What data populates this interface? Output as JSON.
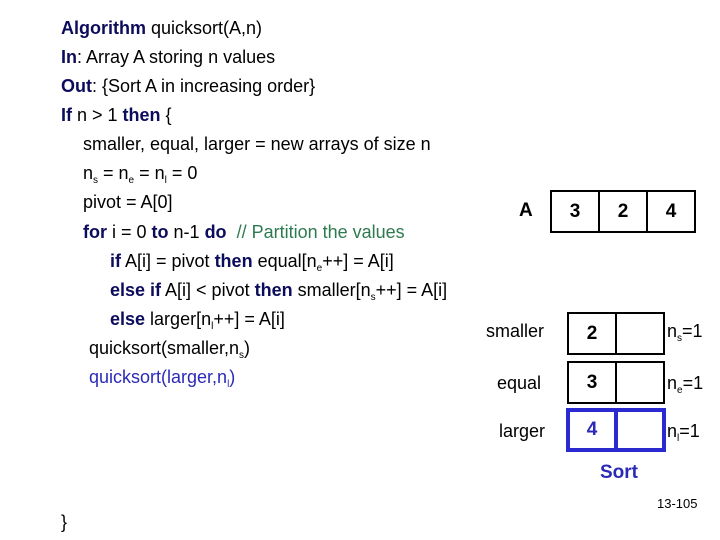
{
  "code": {
    "line1": {
      "kw": "Algorithm",
      "text": " quicksort(A,n)"
    },
    "line2": {
      "kw": "In",
      "text": ": Array A storing n values"
    },
    "line3": {
      "kw": "Out",
      "text": ": {Sort A in increasing order}"
    },
    "line4": {
      "kw1": "If",
      "text1": " n > 1 ",
      "kw2": "then",
      "text2": " {"
    },
    "line5": {
      "text": "smaller, equal, larger = new arrays of size n"
    },
    "line6": {
      "n1": "n",
      "s1": "s",
      "eq1": " = n",
      "s2": "e",
      "eq2": " = n",
      "s3": "l",
      "eq3": " = 0"
    },
    "line7": {
      "text": "pivot = A[0]"
    },
    "line8": {
      "kw1": "for",
      "text1": " i = 0 ",
      "kw2": "to",
      "text2": " n-1 ",
      "kw3": "do",
      "comment": "  // Partition the values"
    },
    "line9": {
      "kw1": "if",
      "text1": " A[i] = pivot ",
      "kw2": "then",
      "text2": " equal[n",
      "sub": "e",
      "text3": "++] = A[i]"
    },
    "line10": {
      "kw1": "else if",
      "text1": " A[i] < pivot ",
      "kw2": "then",
      "text2": " smaller[n",
      "sub": "s",
      "text3": "++] = A[i]"
    },
    "line11": {
      "kw1": "else",
      "text1": " larger[n",
      "sub": "l",
      "text2": "++] = A[i]"
    },
    "line12": {
      "text": "quicksort(smaller,n",
      "sub": "s",
      "text2": ")"
    },
    "line13": {
      "text": "quicksort(larger,n",
      "sub": "l",
      "text2": ")"
    },
    "closing": "}"
  },
  "diagram": {
    "array_a": {
      "label": "A",
      "values": [
        "3",
        "2",
        "4"
      ]
    },
    "smaller": {
      "label": "smaller",
      "values": [
        "2",
        ""
      ],
      "count_var": "n",
      "count_sub": "s",
      "count_val": "=1"
    },
    "equal": {
      "label": "equal",
      "values": [
        "3",
        ""
      ],
      "count_var": "n",
      "count_sub": "e",
      "count_val": "=1"
    },
    "larger": {
      "label": "larger",
      "values": [
        "4",
        ""
      ],
      "count_var": "n",
      "count_sub": "l",
      "count_val": "=1"
    },
    "caption": "Sort"
  },
  "footer": {
    "page_number": "13-105"
  },
  "colors": {
    "keyword": "#0c0c5c",
    "comment": "#2e7a4f",
    "highlight": "#2a2ab8"
  }
}
